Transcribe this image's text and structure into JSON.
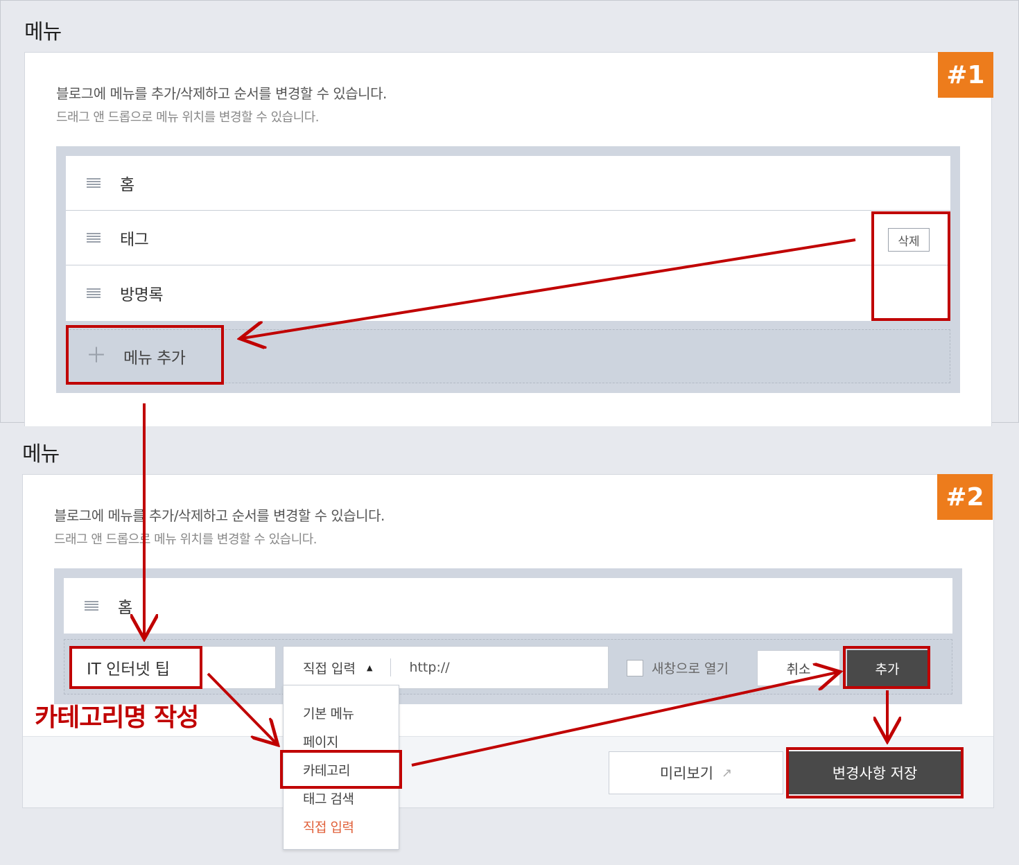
{
  "panel1": {
    "title": "메뉴",
    "badge": "#1",
    "desc_line1": "블로그에 메뉴를 추가/삭제하고 순서를 변경할 수 있습니다.",
    "desc_line2": "드래그 앤 드롭으로 메뉴 위치를 변경할 수 있습니다.",
    "items": [
      {
        "label": "홈"
      },
      {
        "label": "태그"
      },
      {
        "label": "방명록"
      }
    ],
    "delete_label": "삭제",
    "add_menu_label": "메뉴 추가",
    "plus_icon": "＋"
  },
  "panel2": {
    "title": "메뉴",
    "badge": "#2",
    "desc_line1": "블로그에 메뉴를 추가/삭제하고 순서를 변경할 수 있습니다.",
    "desc_line2": "드래그 앤 드롭으로 메뉴 위치를 변경할 수 있습니다.",
    "items": [
      {
        "label": "홈"
      }
    ],
    "name_input_value": "IT 인터넷 팁",
    "type_select_value": "직접 입력",
    "type_select_arrow": "▲",
    "url_input_value": "http://",
    "new_window_label": "새창으로 열기",
    "cancel_label": "취소",
    "add_label": "추가",
    "dropdown_options": [
      "기본 메뉴",
      "페이지",
      "카테고리",
      "태그 검색",
      "직접 입력"
    ],
    "dropdown_selected": "직접 입력",
    "preview_label": "미리보기",
    "external_link_icon": "↗",
    "save_label": "변경사항 저장",
    "annotation": "카테고리명 작성"
  },
  "colors": {
    "badge": "#ed7c1c",
    "highlight": "#c00000",
    "dark_button": "#494949",
    "selected_option": "#e0603a"
  }
}
